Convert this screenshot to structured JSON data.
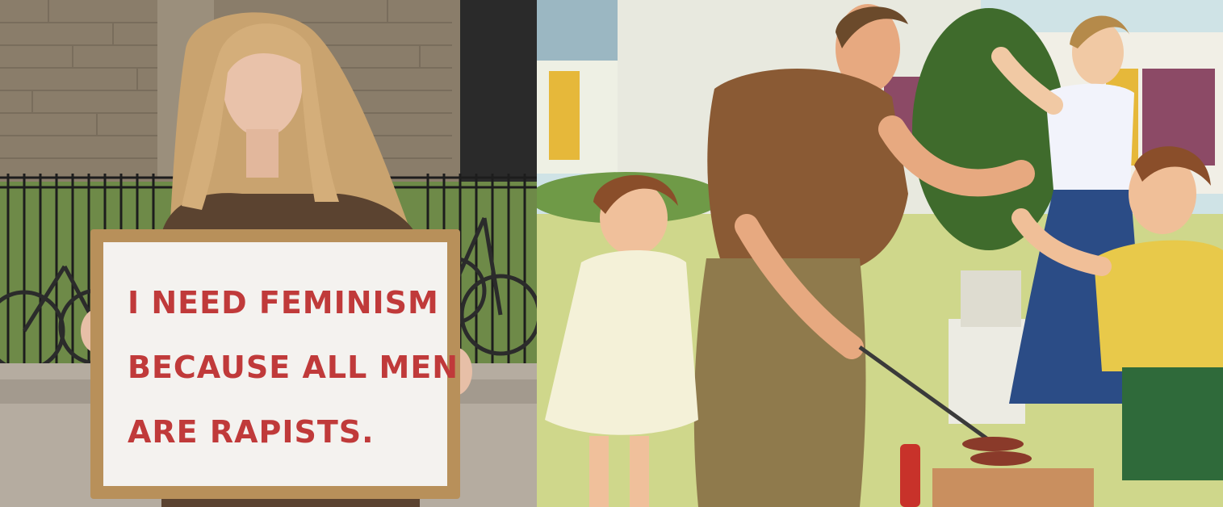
{
  "left_photo": {
    "sign": {
      "line1": "I NEED FEMINISM",
      "line2": "BECAUSE ALL MEN",
      "line3": "ARE RAPISTS."
    }
  },
  "colors": {
    "sign_text": "#c03a3a",
    "sign_frame": "#b8905a",
    "sign_board": "#f4f2ef",
    "brick_wall": "#8a7d6a",
    "grass": "#cfd78b",
    "sky": "#cfe3e6"
  }
}
